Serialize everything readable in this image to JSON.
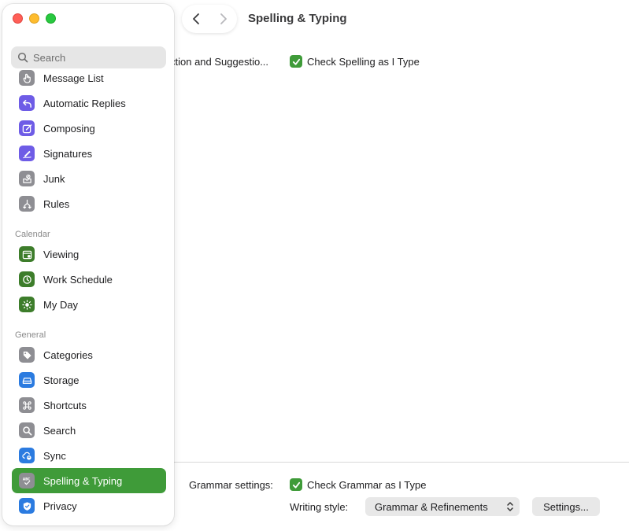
{
  "window": {
    "title": "Spelling & Typing"
  },
  "search": {
    "placeholder": "Search"
  },
  "sidebar": {
    "mail_items": [
      {
        "label": "Message List",
        "icon": "hand-pointer-icon"
      },
      {
        "label": "Automatic Replies",
        "icon": "reply-arrow-icon"
      },
      {
        "label": "Composing",
        "icon": "compose-pencil-icon"
      },
      {
        "label": "Signatures",
        "icon": "signature-pen-icon"
      },
      {
        "label": "Junk",
        "icon": "junk-tray-icon"
      },
      {
        "label": "Rules",
        "icon": "rules-arrows-icon"
      }
    ],
    "calendar_header": "Calendar",
    "calendar_items": [
      {
        "label": "Viewing",
        "icon": "calendar-view-icon"
      },
      {
        "label": "Work Schedule",
        "icon": "clock-icon"
      },
      {
        "label": "My Day",
        "icon": "sun-icon"
      }
    ],
    "general_header": "General",
    "general_items": [
      {
        "label": "Categories",
        "icon": "tag-icon"
      },
      {
        "label": "Storage",
        "icon": "drive-icon"
      },
      {
        "label": "Shortcuts",
        "icon": "command-key-icon"
      },
      {
        "label": "Search",
        "icon": "magnifier-icon"
      },
      {
        "label": "Sync",
        "icon": "cloud-sync-icon"
      },
      {
        "label": "Spelling & Typing",
        "icon": "spellcheck-icon",
        "active": true
      },
      {
        "label": "Privacy",
        "icon": "shield-icon"
      }
    ]
  },
  "content": {
    "autocorrect_label": "ction and Suggestio...",
    "check_spelling_label": "Check Spelling as I Type",
    "check_spelling_checked": true,
    "grammar_settings_label": "Grammar settings:",
    "check_grammar_label": "Check Grammar as I Type",
    "check_grammar_checked": true,
    "writing_style_label": "Writing style:",
    "writing_style_value": "Grammar & Refinements",
    "settings_button": "Settings..."
  },
  "colors": {
    "accent": "#3f9b39",
    "close": "#ff5f57",
    "minimize": "#febc2e",
    "maximize": "#28c840"
  }
}
